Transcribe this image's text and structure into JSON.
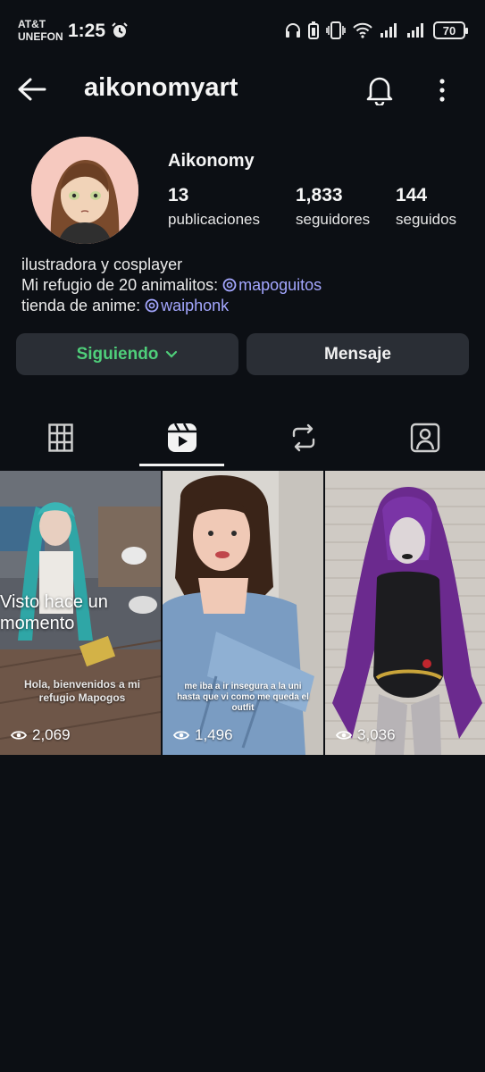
{
  "status_bar": {
    "carrier_line1": "AT&T",
    "carrier_line2": "UNEFON",
    "time": "1:25",
    "battery": "70"
  },
  "header": {
    "username": "aikonomyart"
  },
  "profile": {
    "display_name": "Aikonomy",
    "stats": [
      {
        "value": "13",
        "label": "publicaciones"
      },
      {
        "value": "1,833",
        "label": "seguidores"
      },
      {
        "value": "144",
        "label": "seguidos"
      }
    ],
    "bio": {
      "line1": "ilustradora y cosplayer",
      "line2_prefix": "Mi refugio de 20 animalitos: ",
      "line2_mention": "mapoguitos",
      "line3_prefix": "tienda de anime: ",
      "line3_mention": "waiphonk"
    }
  },
  "actions": {
    "following_label": "Siguiendo",
    "message_label": "Mensaje"
  },
  "tabs": [
    {
      "icon": "grid-icon"
    },
    {
      "icon": "reels-icon",
      "active": true
    },
    {
      "icon": "repost-icon"
    },
    {
      "icon": "tagged-icon"
    }
  ],
  "reels": [
    {
      "views": "2,069",
      "overlay": "Visto hace un momento",
      "caption": "Hola, bienvenidos a mi refugio Mapogos"
    },
    {
      "views": "1,496",
      "caption": "me iba a ir insegura a la uni hasta que vi como me queda el outfit"
    },
    {
      "views": "3,036"
    }
  ],
  "colors": {
    "background": "#0c0f14",
    "button_bg": "#2a2e35",
    "following_green": "#4fcf7a",
    "mention_blue": "#a4a7ff"
  }
}
